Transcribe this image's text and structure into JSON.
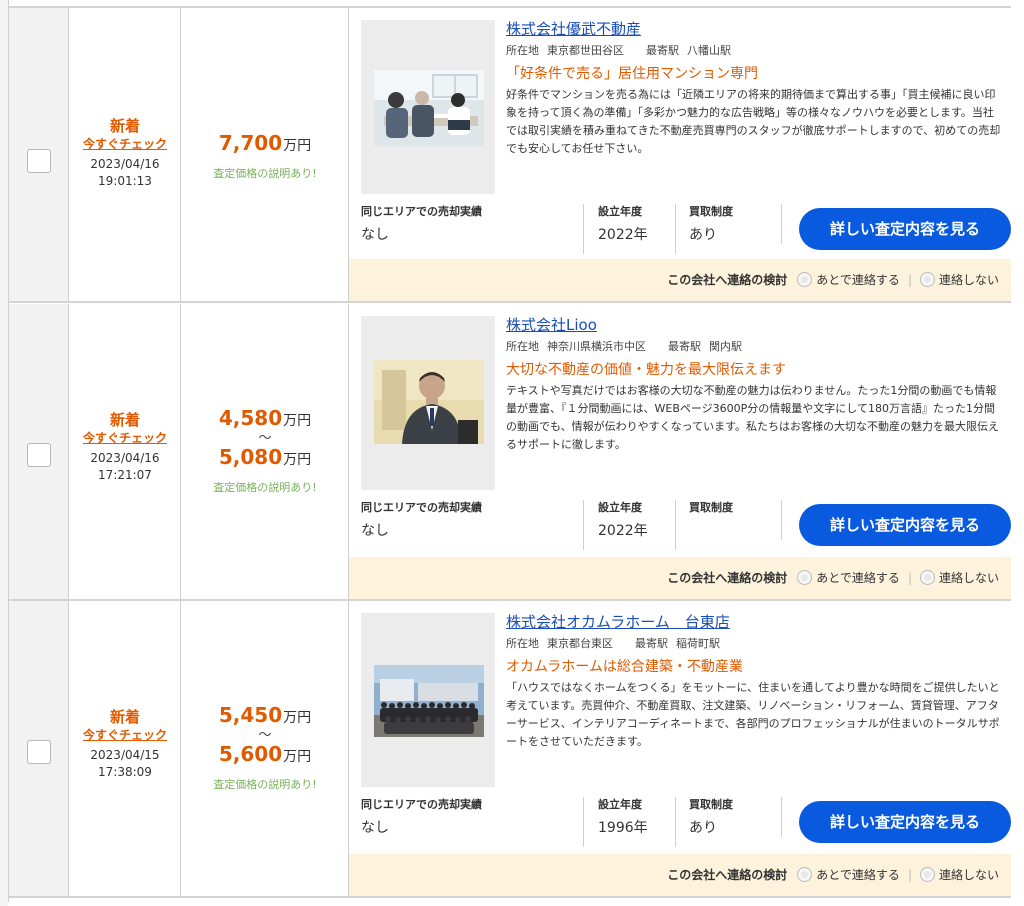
{
  "common": {
    "new_label": "新着",
    "check_now": "今すぐチェック",
    "price_unit": "万円",
    "price_tilde": "〜",
    "price_note": "査定価格の説明あり!",
    "location_label": "所在地",
    "station_label": "最寄駅",
    "stat_sales_label": "同じエリアでの売却実績",
    "stat_year_label": "設立年度",
    "stat_buy_label": "買取制度",
    "detail_button": "詳しい査定内容を見る",
    "contact_question": "この会社へ連絡の検討",
    "contact_later": "あとで連絡する",
    "contact_no": "連絡しない"
  },
  "rows": [
    {
      "date": "2023/04/16",
      "time": "19:01:13",
      "price_min": "7,700",
      "price_max": "",
      "company": "株式会社優武不動産",
      "location": "東京都世田谷区",
      "station": "八幡山駅",
      "headline": "「好条件で売る」居住用マンション専門",
      "description": "好条件でマンションを売る為には「近隣エリアの将来的期待価まで算出する事」「買主候補に良い印象を持って頂く為の準備」「多彩かつ魅力的な広告戦略」等の様々なノウハウを必要とします。当社では取引実績を積み重ねてきた不動産売買専門のスタッフが徹底サポートしますので、初めての売却でも安心してお任せ下さい。",
      "sales_record": "なし",
      "established": "2022年",
      "buyback": "あり"
    },
    {
      "date": "2023/04/16",
      "time": "17:21:07",
      "price_min": "4,580",
      "price_max": "5,080",
      "company": "株式会社Lioo",
      "location": "神奈川県横浜市中区",
      "station": "関内駅",
      "headline": "大切な不動産の価値・魅力を最大限伝えます",
      "description": "テキストや写真だけではお客様の大切な不動産の魅力は伝わりません。たった1分間の動画でも情報量が豊富、『１分間動画には、WEBページ3600P分の情報量や文字にして180万言語』たった1分間の動画でも、情報が伝わりやすくなっています。私たちはお客様の大切な不動産の魅力を最大限伝えるサポートに徹します。",
      "sales_record": "なし",
      "established": "2022年",
      "buyback": ""
    },
    {
      "date": "2023/04/15",
      "time": "17:38:09",
      "price_min": "5,450",
      "price_max": "5,600",
      "company": "株式会社オカムラホーム　台東店",
      "location": "東京都台東区",
      "station": "稲荷町駅",
      "headline": "オカムラホームは総合建築・不動産業",
      "description": "「ハウスではなくホームをつくる」をモットーに、住まいを通してより豊かな時間をご提供したいと考えています。売買仲介、不動産買取、注文建築、リノベーション・リフォーム、賃貸管理、アフターサービス、インテリアコーディネートまで、各部門のプロフェッショナルが住まいのトータルサポートをさせていただきます。",
      "sales_record": "なし",
      "established": "1996年",
      "buyback": "あり"
    }
  ]
}
